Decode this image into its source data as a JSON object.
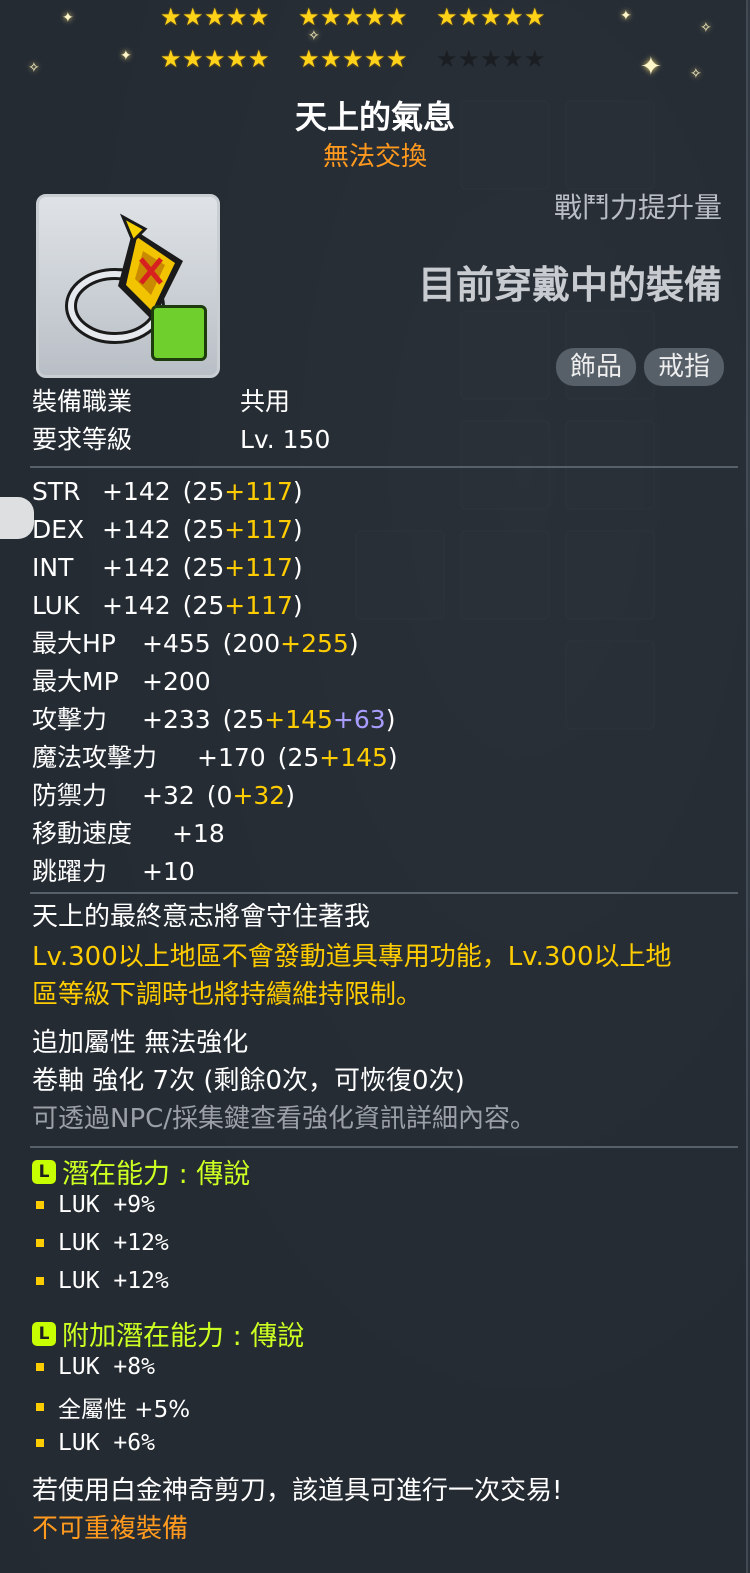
{
  "item": {
    "name": "天上的氣息",
    "tradeability": "無法交換"
  },
  "star_force": {
    "row1_groups": [
      5,
      5,
      5
    ],
    "row2_filled": [
      5,
      5
    ],
    "row2_empty": 5
  },
  "panel": {
    "combat_power_label": "戰鬥力提升量",
    "equipped_label": "目前穿戴中的裝備",
    "tags": [
      "飾品",
      "戒指"
    ]
  },
  "requirements": [
    {
      "label": "裝備職業",
      "value": "共用"
    },
    {
      "label": "要求等級",
      "value": "Lv. 150"
    }
  ],
  "stats": [
    {
      "label": "STR",
      "total": "+142",
      "base": "(25 ",
      "bonus": "+117",
      "extra": "",
      "close": ")"
    },
    {
      "label": "DEX",
      "total": "+142",
      "base": "(25 ",
      "bonus": "+117",
      "extra": "",
      "close": ")"
    },
    {
      "label": "INT",
      "total": "+142",
      "base": "(25 ",
      "bonus": "+117",
      "extra": "",
      "close": ")"
    },
    {
      "label": "LUK",
      "total": "+142",
      "base": "(25 ",
      "bonus": "+117",
      "extra": "",
      "close": ")"
    },
    {
      "label": "最大HP",
      "total": "+455",
      "base": "(200 ",
      "bonus": "+255",
      "extra": "",
      "close": ")"
    },
    {
      "label": "最大MP",
      "total": "+200",
      "base": "",
      "bonus": "",
      "extra": "",
      "close": ""
    },
    {
      "label": "攻擊力",
      "total": "+233",
      "base": "(25 ",
      "bonus": "+145",
      "extra": " +63",
      "close": ")"
    },
    {
      "label": "魔法攻擊力",
      "total": "+170",
      "base": "(25 ",
      "bonus": "+145",
      "extra": "",
      "close": ")"
    },
    {
      "label": "防禦力",
      "total": "+32",
      "base": "(0 ",
      "bonus": "+32",
      "extra": "",
      "close": ")"
    },
    {
      "label": "移動速度",
      "total": "+18",
      "base": "",
      "bonus": "",
      "extra": "",
      "close": ""
    },
    {
      "label": "跳躍力",
      "total": "+10",
      "base": "",
      "bonus": "",
      "extra": "",
      "close": ""
    }
  ],
  "description": {
    "flavor": "天上的最終意志將會守住著我",
    "warning_line1": "Lv.300以上地區不會發動道具專用功能，Lv.300以上地",
    "warning_line2": "區等級下調時也將持續維持限制。",
    "add_option": "追加屬性 無法強化",
    "scroll": "卷軸 強化 7次 (剩餘0次，可恢復0次)",
    "npc_hint": "可透過NPC/採集鍵查看強化資訊詳細內容。"
  },
  "potential": {
    "badge": "L",
    "title": "潛在能力 : 傳說",
    "lines": [
      "LUK +9%",
      "LUK +12%",
      "LUK +12%"
    ]
  },
  "additional_potential": {
    "badge": "L",
    "title": "附加潛在能力 : 傳說",
    "lines": [
      "LUK +8%",
      "全屬性 +5%",
      "LUK +6%"
    ]
  },
  "footer": {
    "scissors": "若使用白金神奇剪刀，該道具可進行一次交易!",
    "unique": "不可重複裝備"
  },
  "colors": {
    "star_on": "#ffd21a",
    "bonus_yellow": "#ffcc00",
    "bonus_purple": "#a99cff",
    "orange": "#ff9a1f",
    "legendary_green": "#ccff22"
  }
}
